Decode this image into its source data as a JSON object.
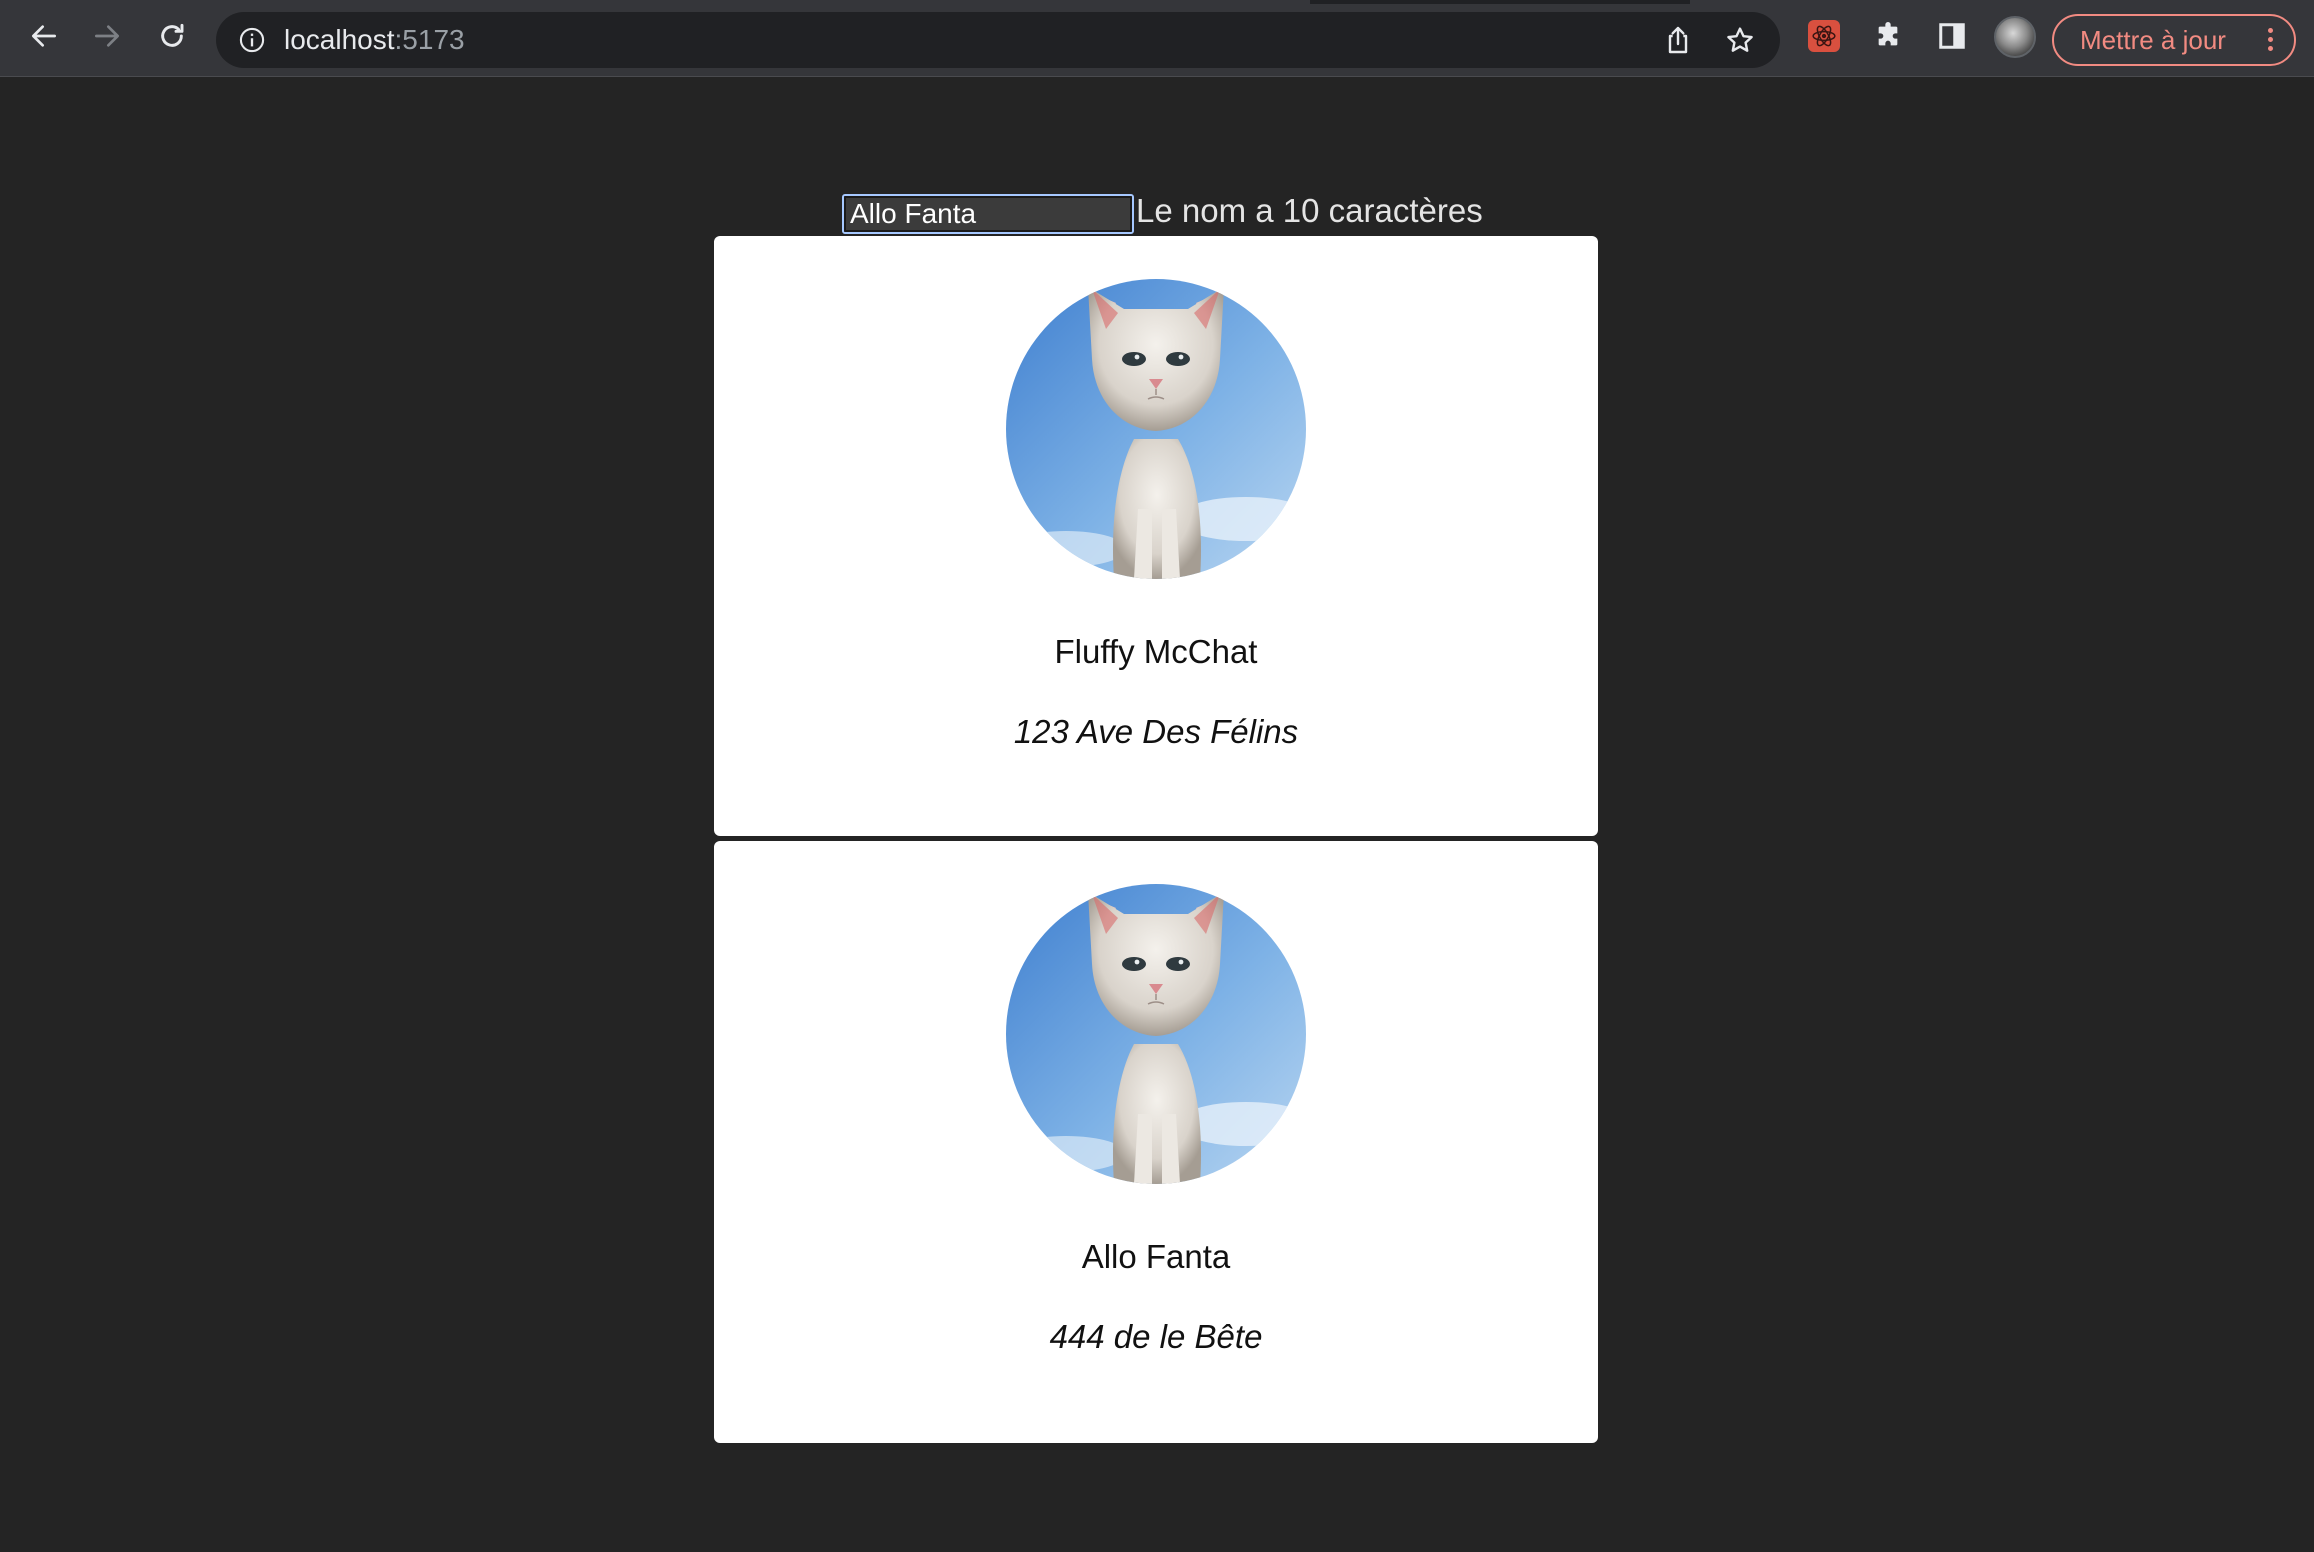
{
  "browser": {
    "url_host": "localhost",
    "url_port": ":5173",
    "update_label": "Mettre à jour",
    "accent_color": "#f28b82"
  },
  "form": {
    "name_value": "Allo Fanta",
    "length_message": "Le nom a 10 caractères"
  },
  "cards": [
    {
      "name": "Fluffy McChat",
      "address": "123 Ave Des Félins",
      "photo": "white-kitten"
    },
    {
      "name": "Allo Fanta",
      "address": "444 de le Bête",
      "photo": "white-kitten"
    }
  ]
}
